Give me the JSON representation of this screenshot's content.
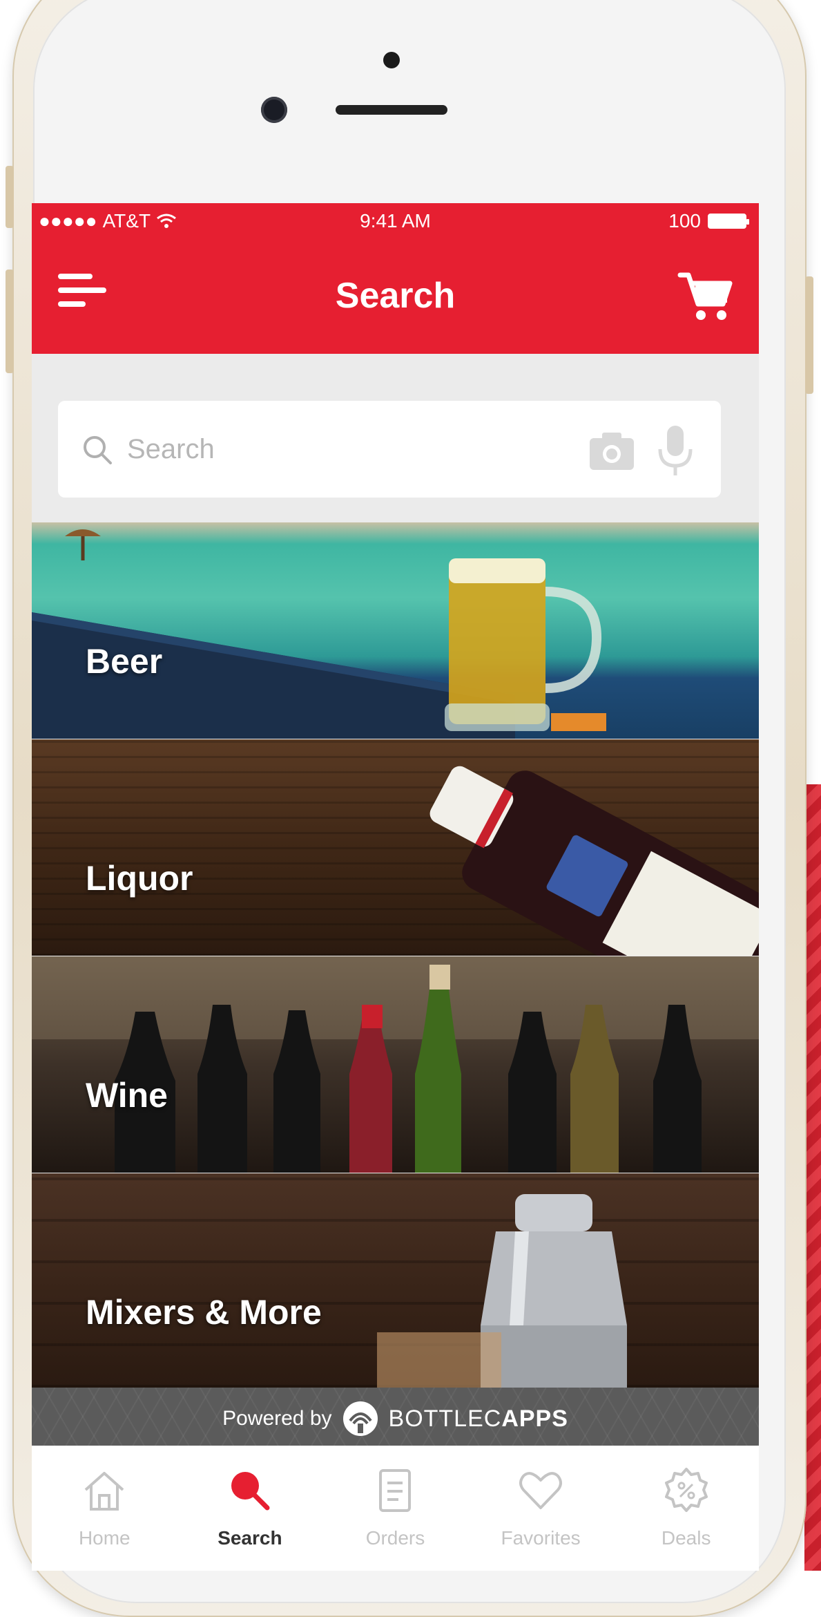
{
  "status_bar": {
    "carrier": "AT&T",
    "signal": "●●●●●",
    "time": "9:41 AM",
    "battery": "100"
  },
  "header": {
    "title": "Search",
    "menu_icon": "hamburger-menu-icon",
    "cart_icon": "shopping-cart-icon"
  },
  "search": {
    "placeholder": "Search",
    "value": ""
  },
  "categories": [
    {
      "label": "Beer"
    },
    {
      "label": "Liquor"
    },
    {
      "label": "Wine"
    },
    {
      "label": "Mixers & More"
    }
  ],
  "footer": {
    "powered_by": "Powered by",
    "brand_light": "BOTTLEC",
    "brand_bold": "APPS"
  },
  "tabs": [
    {
      "label": "Home",
      "icon": "home-icon",
      "active": false
    },
    {
      "label": "Search",
      "icon": "search-icon",
      "active": true
    },
    {
      "label": "Orders",
      "icon": "orders-icon",
      "active": false
    },
    {
      "label": "Favorites",
      "icon": "heart-icon",
      "active": false
    },
    {
      "label": "Deals",
      "icon": "deals-icon",
      "active": false
    }
  ],
  "colors": {
    "brand_red": "#e61f31",
    "tab_inactive": "#c4c4c4",
    "tab_active": "#333333"
  }
}
